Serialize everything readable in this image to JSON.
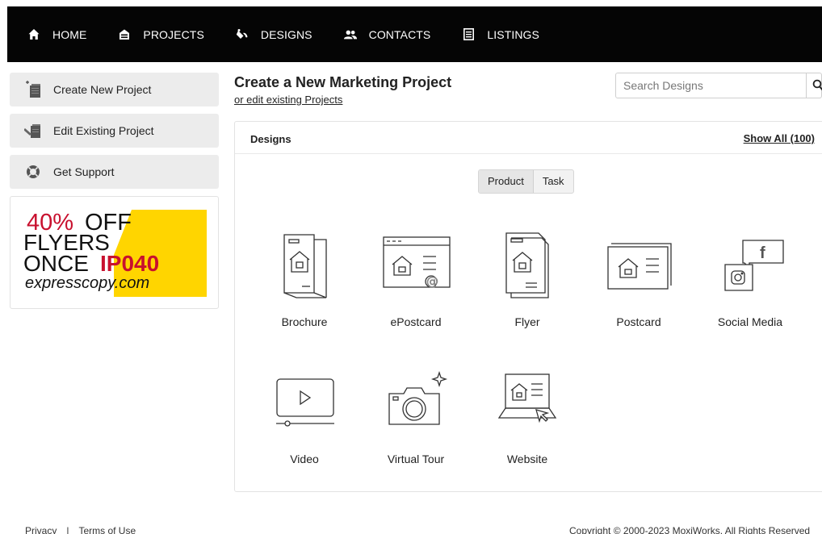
{
  "nav": {
    "items": [
      {
        "label": "HOME",
        "icon": "home-icon"
      },
      {
        "label": "PROJECTS",
        "icon": "projects-icon"
      },
      {
        "label": "DESIGNS",
        "icon": "paint-bucket-icon"
      },
      {
        "label": "CONTACTS",
        "icon": "contacts-icon"
      },
      {
        "label": "LISTINGS",
        "icon": "listings-icon"
      }
    ]
  },
  "sidebar": {
    "items": [
      {
        "label": "Create New Project",
        "icon": "new-project-icon"
      },
      {
        "label": "Edit Existing Project",
        "icon": "edit-project-icon"
      },
      {
        "label": "Get Support",
        "icon": "lifebuoy-icon"
      }
    ],
    "promo": {
      "line1_pct": "40%",
      "line1_rest": " OFF",
      "line2": "FLYERS",
      "line3": "ONCE",
      "code": "IP040",
      "site": "expresscopy.com",
      "colors": {
        "accent": "#c8102e",
        "band": "#ffd500",
        "text": "#111111"
      }
    }
  },
  "header": {
    "title": "Create a New Marketing Project",
    "sub_link": "or edit existing Projects",
    "search_placeholder": "Search Designs"
  },
  "designs": {
    "title": "Designs",
    "show_all": "Show All (100)",
    "toggle": [
      {
        "label": "Product",
        "active": true
      },
      {
        "label": "Task",
        "active": false
      }
    ],
    "tiles": [
      {
        "label": "Brochure",
        "icon": "brochure-icon"
      },
      {
        "label": "ePostcard",
        "icon": "epostcard-icon"
      },
      {
        "label": "Flyer",
        "icon": "flyer-icon"
      },
      {
        "label": "Postcard",
        "icon": "postcard-icon"
      },
      {
        "label": "Social Media",
        "icon": "social-media-icon"
      },
      {
        "label": "Video",
        "icon": "video-icon"
      },
      {
        "label": "Virtual Tour",
        "icon": "camera-icon"
      },
      {
        "label": "Website",
        "icon": "website-icon"
      }
    ]
  },
  "footer": {
    "privacy": "Privacy",
    "separator": "|",
    "terms": "Terms of Use",
    "copyright": "Copyright © 2000-2023 MoxiWorks. All Rights Reserved"
  }
}
